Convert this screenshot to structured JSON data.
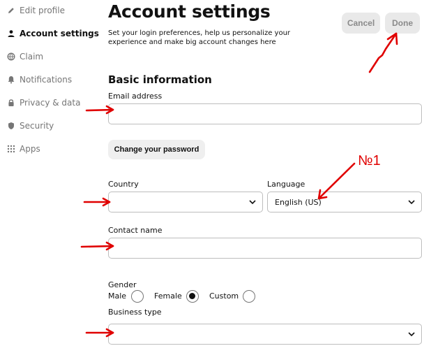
{
  "sidebar": {
    "items": [
      {
        "label": "Edit profile",
        "icon": "pencil-icon",
        "active": false
      },
      {
        "label": "Account settings",
        "icon": "person-icon",
        "active": true
      },
      {
        "label": "Claim",
        "icon": "globe-icon",
        "active": false
      },
      {
        "label": "Notifications",
        "icon": "bell-icon",
        "active": false
      },
      {
        "label": "Privacy & data",
        "icon": "lock-icon",
        "active": false
      },
      {
        "label": "Security",
        "icon": "shield-icon",
        "active": false
      },
      {
        "label": "Apps",
        "icon": "grid-icon",
        "active": false
      }
    ]
  },
  "header": {
    "title": "Account settings",
    "subtitle": "Set your login preferences, help us personalize your experience and make big account changes here",
    "cancel_label": "Cancel",
    "done_label": "Done"
  },
  "basic_info": {
    "heading": "Basic information",
    "email_label": "Email address",
    "email_value": "",
    "change_password_label": "Change your password",
    "country_label": "Country",
    "country_value": "",
    "language_label": "Language",
    "language_value": "English (US)",
    "contact_name_label": "Contact name",
    "contact_name_value": "",
    "gender_label": "Gender",
    "gender_options": [
      "Male",
      "Female",
      "Custom"
    ],
    "gender_selected": "Female",
    "business_type_label": "Business type",
    "business_type_value": ""
  },
  "annotation": {
    "text": "№1",
    "color": "#e00000"
  },
  "colors": {
    "text": "#111111",
    "muted": "#767676",
    "button_bg": "#e9e9e9",
    "border": "#bdbdbd",
    "annotation": "#e00000"
  }
}
